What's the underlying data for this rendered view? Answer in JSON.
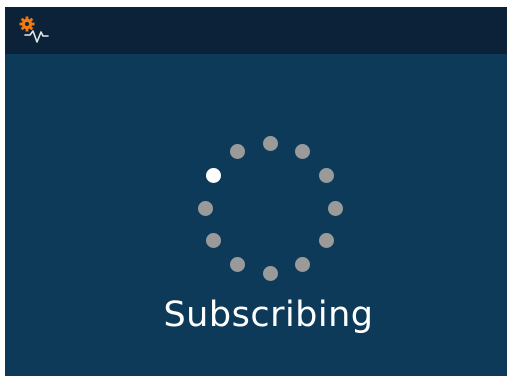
{
  "header": {
    "app_icon": "settings-activity-icon",
    "accent_color": "#f07a14"
  },
  "status": {
    "text": "Subscribing",
    "spinner_dot_count": 12,
    "active_dot_index": 0
  },
  "colors": {
    "background": "#0c3a58",
    "topbar": "#0b2238",
    "dot_inactive": "#9a9a9a",
    "dot_active": "#ffffff",
    "text": "#ffffff"
  }
}
